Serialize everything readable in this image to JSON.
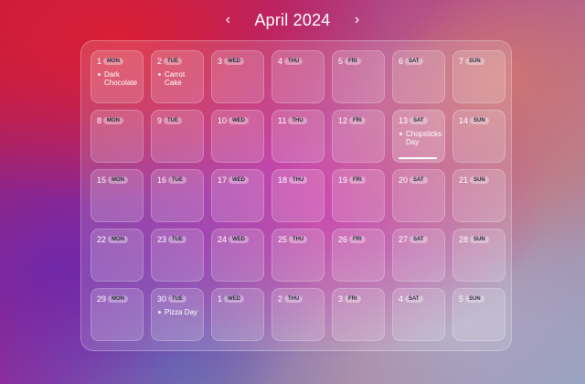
{
  "header": {
    "title": "April 2024",
    "prev_glyph": "‹",
    "next_glyph": "›"
  },
  "weeks": [
    [
      {
        "num": "1",
        "dow": "MON",
        "events": [
          "Dark Chocolate"
        ]
      },
      {
        "num": "2",
        "dow": "TUE",
        "events": [
          "Carrot Cake"
        ]
      },
      {
        "num": "3",
        "dow": "WED",
        "events": []
      },
      {
        "num": "4",
        "dow": "THU",
        "events": []
      },
      {
        "num": "5",
        "dow": "FRI",
        "events": []
      },
      {
        "num": "6",
        "dow": "SAT",
        "events": []
      },
      {
        "num": "7",
        "dow": "SUN",
        "events": []
      }
    ],
    [
      {
        "num": "8",
        "dow": "MON",
        "events": []
      },
      {
        "num": "9",
        "dow": "TUE",
        "events": []
      },
      {
        "num": "10",
        "dow": "WED",
        "events": []
      },
      {
        "num": "11",
        "dow": "THU",
        "events": []
      },
      {
        "num": "12",
        "dow": "FRI",
        "events": []
      },
      {
        "num": "13",
        "dow": "SAT",
        "events": [
          "Chopsticks Day"
        ],
        "selected": true
      },
      {
        "num": "14",
        "dow": "SUN",
        "events": []
      }
    ],
    [
      {
        "num": "15",
        "dow": "MON",
        "events": []
      },
      {
        "num": "16",
        "dow": "TUE",
        "events": []
      },
      {
        "num": "17",
        "dow": "WED",
        "events": []
      },
      {
        "num": "18",
        "dow": "THU",
        "events": []
      },
      {
        "num": "19",
        "dow": "FRI",
        "events": []
      },
      {
        "num": "20",
        "dow": "SAT",
        "events": []
      },
      {
        "num": "21",
        "dow": "SUN",
        "events": []
      }
    ],
    [
      {
        "num": "22",
        "dow": "MON",
        "events": []
      },
      {
        "num": "23",
        "dow": "TUE",
        "events": []
      },
      {
        "num": "24",
        "dow": "WED",
        "events": []
      },
      {
        "num": "25",
        "dow": "THU",
        "events": []
      },
      {
        "num": "26",
        "dow": "FRI",
        "events": []
      },
      {
        "num": "27",
        "dow": "SAT",
        "events": []
      },
      {
        "num": "28",
        "dow": "SUN",
        "events": []
      }
    ],
    [
      {
        "num": "29",
        "dow": "MON",
        "events": []
      },
      {
        "num": "30",
        "dow": "TUE",
        "events": [
          "Pizza Day"
        ]
      },
      {
        "num": "1",
        "dow": "WED",
        "events": []
      },
      {
        "num": "2",
        "dow": "THU",
        "events": []
      },
      {
        "num": "3",
        "dow": "FRI",
        "events": []
      },
      {
        "num": "4",
        "dow": "SAT",
        "events": []
      },
      {
        "num": "5",
        "dow": "SUN",
        "events": []
      }
    ]
  ]
}
